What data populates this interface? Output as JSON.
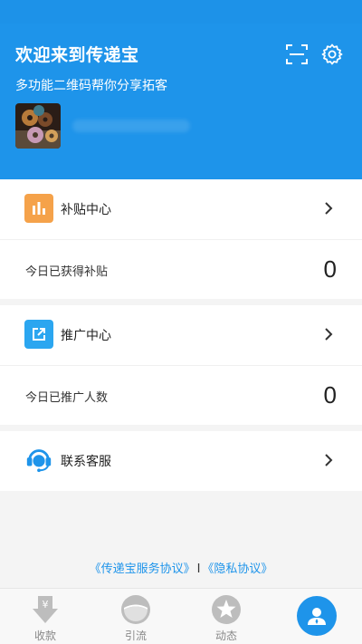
{
  "header": {
    "title": "欢迎来到传递宝",
    "subtitle": "多功能二维码帮你分享拓客",
    "icons": [
      "scan-icon",
      "gear-icon"
    ]
  },
  "subsidy": {
    "label": "补贴中心",
    "stat_label": "今日已获得补贴",
    "stat_value": "0",
    "icon": "bar-chart-icon",
    "icon_color": "#f5a24a"
  },
  "promotion": {
    "label": "推广中心",
    "stat_label": "今日已推广人数",
    "stat_value": "0",
    "icon": "share-out-icon",
    "icon_color": "#2ba6f0"
  },
  "service": {
    "label": "联系客服",
    "icon": "headset-agent-icon"
  },
  "agreements": {
    "service_agreement": "《传递宝服务协议》",
    "separator": "I",
    "privacy_agreement": "《隐私协议》"
  },
  "tabbar": {
    "tabs": [
      {
        "label": "收款",
        "icon": "yen-icon"
      },
      {
        "label": "引流",
        "icon": "globe-half-icon"
      },
      {
        "label": "动态",
        "icon": "star-icon"
      },
      {
        "label": "",
        "icon": "user-icon",
        "active": true
      }
    ]
  },
  "colors": {
    "primary": "#1e94ea",
    "background": "#f4f4f4"
  }
}
